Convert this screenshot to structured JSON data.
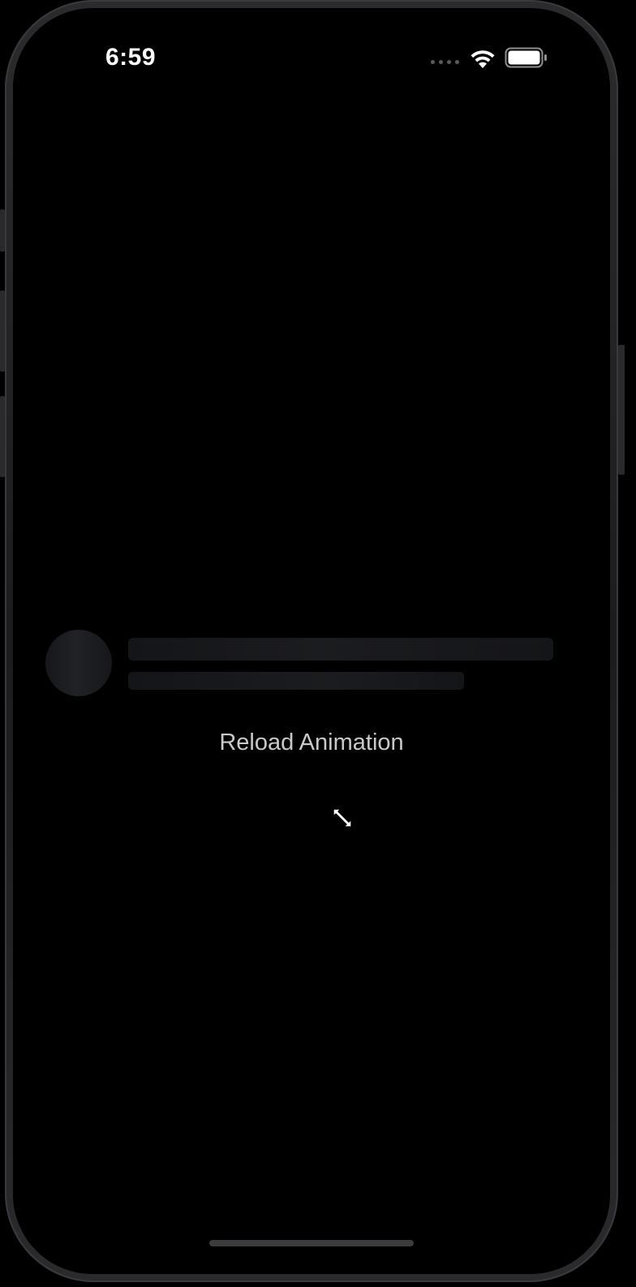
{
  "status_bar": {
    "time": "6:59",
    "icons": [
      "cellular-dots-icon",
      "wifi-icon",
      "battery-icon"
    ]
  },
  "skeleton_loader": {
    "avatar_placeholder": "circle",
    "line_placeholders": 2
  },
  "main": {
    "reload_button_label": "Reload Animation"
  },
  "cursor": {
    "icon": "resize-diagonal-cursor-icon"
  },
  "colors": {
    "background": "#000000",
    "text_primary": "#ffffff",
    "button_text": "#c9c9cc",
    "skeleton": "#1b1c1f",
    "home_indicator": "#3c3c3e"
  }
}
